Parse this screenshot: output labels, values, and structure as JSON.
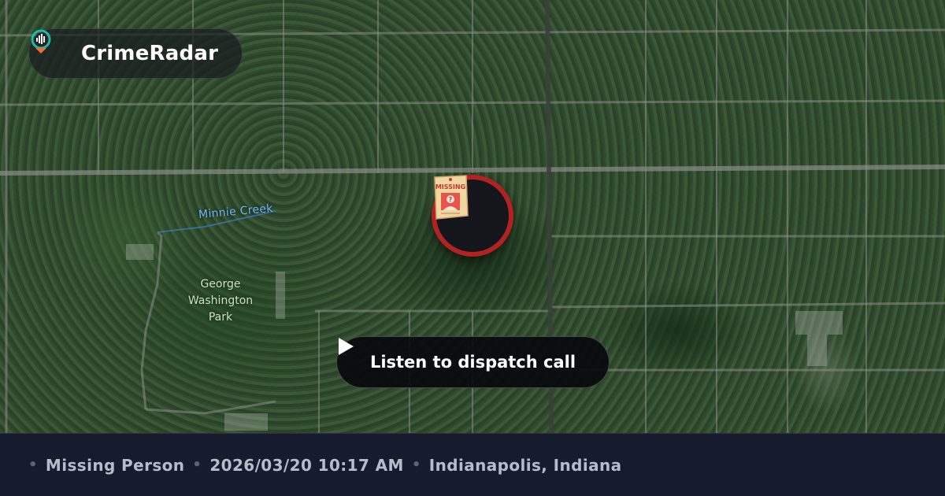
{
  "app": {
    "name": "CrimeRadar",
    "logo_icon": "radar-pin-icon"
  },
  "map": {
    "labels": {
      "park": [
        "George",
        "Washington",
        "Park"
      ],
      "creek": "Minnie Creek"
    },
    "marker": {
      "icon": "missing-poster-icon",
      "poster_text": "MISSING",
      "ring_color": "#b32222"
    }
  },
  "action": {
    "listen_label": "Listen to dispatch call",
    "icon": "play-icon"
  },
  "footer": {
    "separator": "•",
    "incident_type": "Missing Person",
    "datetime": "2026/03/20 10:17 AM",
    "location": "Indianapolis, Indiana"
  }
}
